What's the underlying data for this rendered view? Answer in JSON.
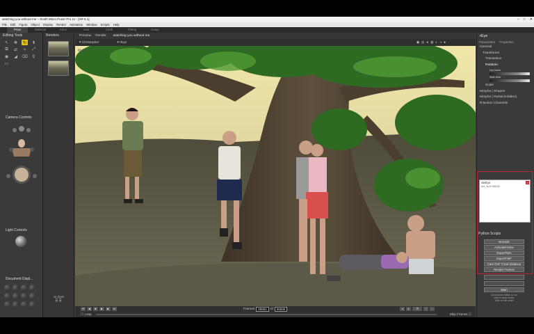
{
  "window": {
    "title": "watching you without me – Smith Micro Poser Pro 11 - [SR 5.1]",
    "controls": [
      "–",
      "□",
      "✕"
    ]
  },
  "menu": [
    "File",
    "Edit",
    "Figure",
    "Object",
    "Display",
    "Render",
    "Animation",
    "Window",
    "Scripts",
    "Help"
  ],
  "rooms": [
    {
      "label": "Pose",
      "active": true
    },
    {
      "label": "Material",
      "active": false
    },
    {
      "label": "Face",
      "active": false
    },
    {
      "label": "Hair",
      "active": false
    },
    {
      "label": "Cloth",
      "active": false
    },
    {
      "label": "Fitting",
      "active": false
    },
    {
      "label": "Setup",
      "active": false
    }
  ],
  "left": {
    "editing_tools": "Editing Tools",
    "tools": [
      "↖",
      "✥",
      "↻",
      "⬍",
      "⧉",
      "⇄",
      "✧",
      "⤢",
      "◉",
      "◢",
      "⌫",
      "⚲",
      "▭"
    ],
    "camera_controls": "Camera Controls",
    "light_controls": "Light Controls",
    "document_display": "Document Displ..."
  },
  "thumbs": {
    "tab": "Renders"
  },
  "viewport": {
    "preview_tab": "Preview",
    "render_tab": "Render",
    "doc_title": "watching you without me",
    "figure_select": "Christopher",
    "actor_select": "rEye",
    "camera_label": "Main C..."
  },
  "timeline": {
    "frames_label": "Frames",
    "frame_current": "00001",
    "frame_of": "of",
    "frame_total": "00030",
    "loop_label": "Loop",
    "skip_frames": "Skip Frames"
  },
  "ui_dots": "UI Dots",
  "right": {
    "actor_name": "rEye",
    "tabs": [
      "Parameters",
      "Properties"
    ],
    "params": [
      {
        "label": "General",
        "level": 0
      },
      {
        "label": "Transforms",
        "level": 1
      },
      {
        "label": "Translation",
        "level": 2
      },
      {
        "label": "Rotation",
        "level": 2
      }
    ],
    "sliders": [
      {
        "label": "Up-Down",
        "value": 0.7
      },
      {
        "label": "Side-Side",
        "value": 0.7
      }
    ],
    "more_params": [
      {
        "label": "Scale",
        "level": 2
      },
      {
        "label": "Morphs | Shapes",
        "level": 0
      },
      {
        "label": "Morphs | Partial (Hidden)",
        "level": 0
      },
      {
        "label": "RJection Channels",
        "level": 0
      }
    ],
    "script_box_title": "SetEye",
    "script_box_sub": "Aut_3a1f7d8f1b9",
    "python_scripts": "Python Scripts",
    "script_buttons": [
      "NewJob",
      "ActivateFrame",
      "ExportTwin",
      "ExportTWF",
      "Cam OnF Focal Distance",
      "Render Frames",
      "",
      "",
      "Main"
    ],
    "footer": "Click shows button to run\nclick to clear button\nClick to edit script"
  },
  "colors": {
    "accent": "#e2c400",
    "highlight": "#c0283a"
  }
}
